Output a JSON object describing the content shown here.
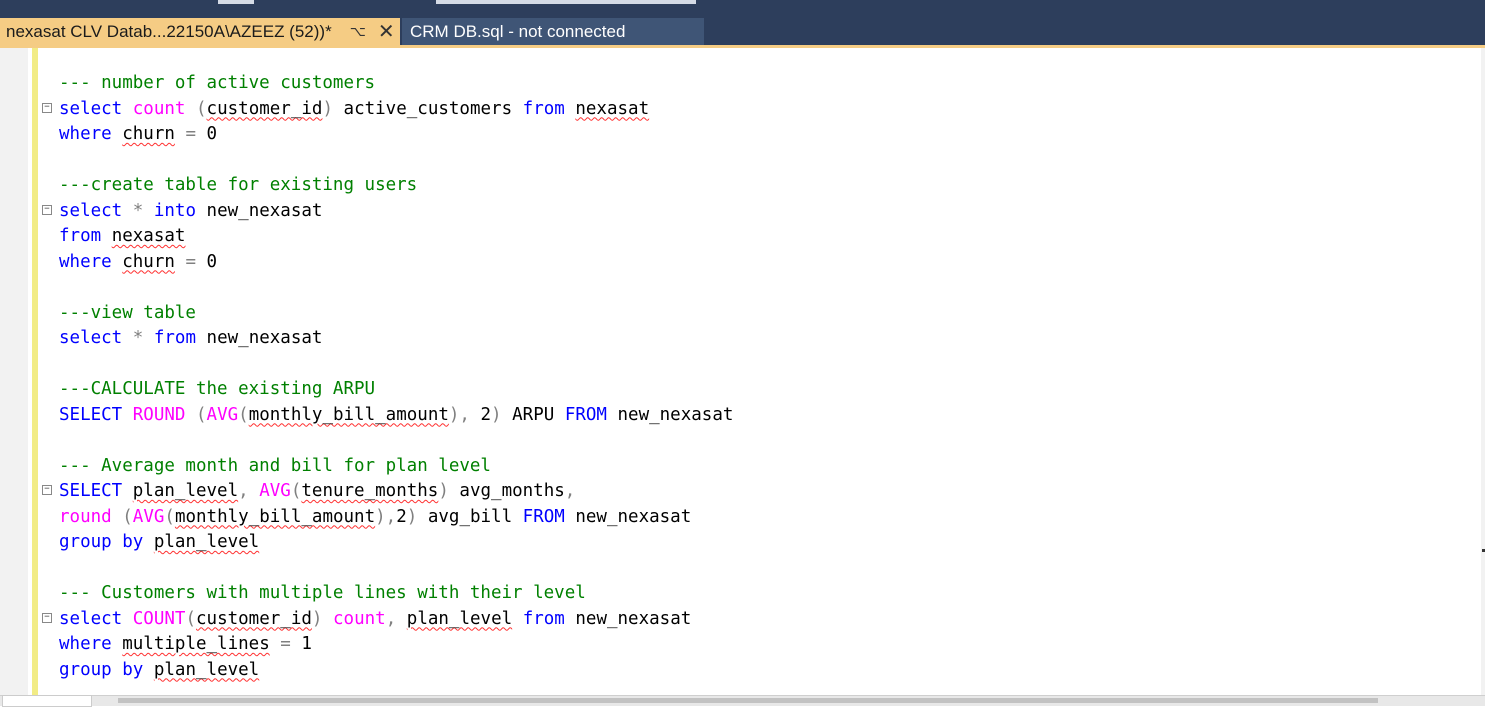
{
  "tabs": [
    {
      "label": "nexasat CLV Datab...22150A\\AZEEZ (52))*",
      "pin_glyph": "⌥",
      "close_glyph": "✕",
      "active": true
    },
    {
      "label": "CRM DB.sql - not connected",
      "active": false
    }
  ],
  "colors": {
    "keyword": "#0000ff",
    "function": "#ff00ff",
    "comment": "#008000",
    "operator": "#808080",
    "squiggle": "#ff3030",
    "active_tab": "#f5cc84",
    "tab_bar": "#2d3e5c"
  },
  "editor": {
    "lines": [
      {
        "fold": false,
        "tokens": [
          [
            "cm",
            "--- number of active customers"
          ]
        ]
      },
      {
        "fold": true,
        "tokens": [
          [
            "kw",
            "select"
          ],
          [
            "t",
            " "
          ],
          [
            "fn",
            "count"
          ],
          [
            "t",
            " "
          ],
          [
            "gr",
            "("
          ],
          [
            "sq",
            "customer_id"
          ],
          [
            "gr",
            ")"
          ],
          [
            "t",
            " active_customers "
          ],
          [
            "kw",
            "from"
          ],
          [
            "t",
            " "
          ],
          [
            "sq",
            "nexasat"
          ]
        ]
      },
      {
        "fold": false,
        "tokens": [
          [
            "kw",
            "where"
          ],
          [
            "t",
            " "
          ],
          [
            "sq",
            "churn"
          ],
          [
            "t",
            " "
          ],
          [
            "gr",
            "="
          ],
          [
            "t",
            " 0"
          ]
        ]
      },
      {
        "fold": false,
        "tokens": []
      },
      {
        "fold": false,
        "tokens": [
          [
            "cm",
            "---create table for existing users"
          ]
        ]
      },
      {
        "fold": true,
        "tokens": [
          [
            "kw",
            "select"
          ],
          [
            "t",
            " "
          ],
          [
            "gr",
            "*"
          ],
          [
            "t",
            " "
          ],
          [
            "kw",
            "into"
          ],
          [
            "t",
            " new_nexasat"
          ]
        ]
      },
      {
        "fold": false,
        "tokens": [
          [
            "kw",
            "from"
          ],
          [
            "t",
            " "
          ],
          [
            "sq",
            "nexasat"
          ]
        ]
      },
      {
        "fold": false,
        "tokens": [
          [
            "kw",
            "where"
          ],
          [
            "t",
            " "
          ],
          [
            "sq",
            "churn"
          ],
          [
            "t",
            " "
          ],
          [
            "gr",
            "="
          ],
          [
            "t",
            " 0"
          ]
        ]
      },
      {
        "fold": false,
        "tokens": []
      },
      {
        "fold": false,
        "tokens": [
          [
            "cm",
            "---view table"
          ]
        ]
      },
      {
        "fold": false,
        "tokens": [
          [
            "kw",
            "select"
          ],
          [
            "t",
            " "
          ],
          [
            "gr",
            "*"
          ],
          [
            "t",
            " "
          ],
          [
            "kw",
            "from"
          ],
          [
            "t",
            " new_nexasat"
          ]
        ]
      },
      {
        "fold": false,
        "tokens": []
      },
      {
        "fold": false,
        "tokens": [
          [
            "cm",
            "---CALCULATE the existing ARPU"
          ]
        ]
      },
      {
        "fold": false,
        "tokens": [
          [
            "kw",
            "SELECT"
          ],
          [
            "t",
            " "
          ],
          [
            "fn",
            "ROUND"
          ],
          [
            "t",
            " "
          ],
          [
            "gr",
            "("
          ],
          [
            "fn",
            "AVG"
          ],
          [
            "gr",
            "("
          ],
          [
            "sq",
            "monthly_bill_amount"
          ],
          [
            "gr",
            "),"
          ],
          [
            "t",
            " 2"
          ],
          [
            "gr",
            ")"
          ],
          [
            "t",
            " ARPU "
          ],
          [
            "kw",
            "FROM"
          ],
          [
            "t",
            " new_nexasat"
          ]
        ]
      },
      {
        "fold": false,
        "tokens": []
      },
      {
        "fold": false,
        "tokens": [
          [
            "cm",
            "--- Average month and bill for plan level"
          ]
        ]
      },
      {
        "fold": true,
        "tokens": [
          [
            "kw",
            "SELECT"
          ],
          [
            "t",
            " "
          ],
          [
            "sq",
            "plan_level"
          ],
          [
            "gr",
            ","
          ],
          [
            "t",
            " "
          ],
          [
            "fn",
            "AVG"
          ],
          [
            "gr",
            "("
          ],
          [
            "sq",
            "tenure_months"
          ],
          [
            "gr",
            ")"
          ],
          [
            "t",
            " avg_months"
          ],
          [
            "gr",
            ","
          ]
        ]
      },
      {
        "fold": false,
        "tokens": [
          [
            "fn",
            "round"
          ],
          [
            "t",
            " "
          ],
          [
            "gr",
            "("
          ],
          [
            "fn",
            "AVG"
          ],
          [
            "gr",
            "("
          ],
          [
            "sq",
            "monthly_bill_amount"
          ],
          [
            "gr",
            "),"
          ],
          [
            "t",
            "2"
          ],
          [
            "gr",
            ")"
          ],
          [
            "t",
            " avg_bill "
          ],
          [
            "kw",
            "FROM"
          ],
          [
            "t",
            " new_nexasat"
          ]
        ]
      },
      {
        "fold": false,
        "tokens": [
          [
            "kw",
            "group"
          ],
          [
            "t",
            " "
          ],
          [
            "kw",
            "by"
          ],
          [
            "t",
            " "
          ],
          [
            "sq",
            "plan_level"
          ]
        ]
      },
      {
        "fold": false,
        "tokens": []
      },
      {
        "fold": false,
        "tokens": [
          [
            "cm",
            "--- Customers with multiple lines with their level"
          ]
        ]
      },
      {
        "fold": true,
        "tokens": [
          [
            "kw",
            "select"
          ],
          [
            "t",
            " "
          ],
          [
            "fn",
            "COUNT"
          ],
          [
            "gr",
            "("
          ],
          [
            "sq",
            "customer_id"
          ],
          [
            "gr",
            ")"
          ],
          [
            "t",
            " "
          ],
          [
            "fn",
            "count"
          ],
          [
            "gr",
            ","
          ],
          [
            "t",
            " "
          ],
          [
            "sq",
            "plan_level"
          ],
          [
            "t",
            " "
          ],
          [
            "kw",
            "from"
          ],
          [
            "t",
            " new_nexasat"
          ]
        ]
      },
      {
        "fold": false,
        "tokens": [
          [
            "kw",
            "where"
          ],
          [
            "t",
            " "
          ],
          [
            "sq",
            "multiple_lines"
          ],
          [
            "t",
            " "
          ],
          [
            "gr",
            "="
          ],
          [
            "t",
            " 1"
          ]
        ]
      },
      {
        "fold": false,
        "tokens": [
          [
            "kw",
            "group"
          ],
          [
            "t",
            " "
          ],
          [
            "kw",
            "by"
          ],
          [
            "t",
            " "
          ],
          [
            "sq",
            "plan_level"
          ]
        ]
      }
    ]
  }
}
